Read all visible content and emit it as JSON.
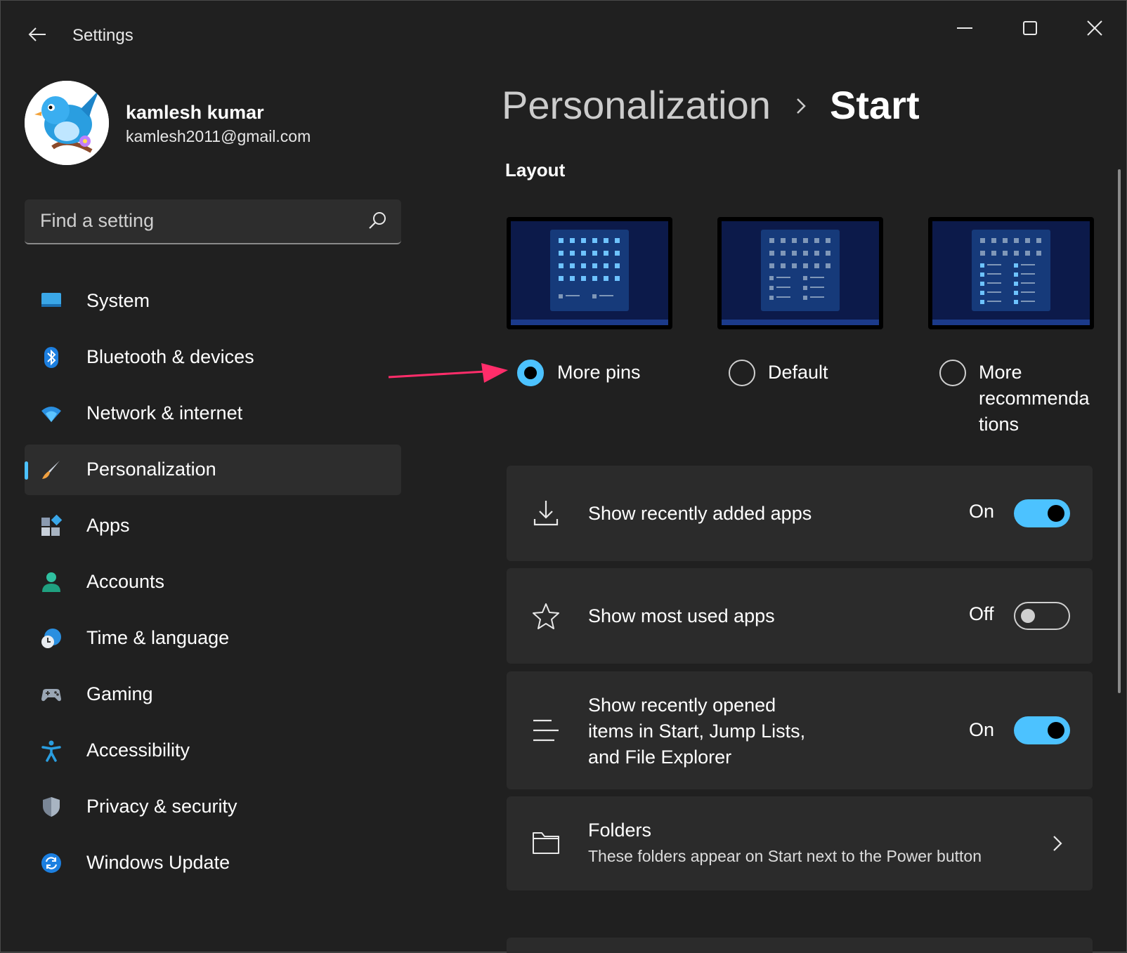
{
  "window": {
    "title": "Settings"
  },
  "profile": {
    "name": "kamlesh kumar",
    "email": "kamlesh2011@gmail.com"
  },
  "search": {
    "placeholder": "Find a setting"
  },
  "nav": {
    "items": [
      {
        "label": "System",
        "icon": "monitor-icon"
      },
      {
        "label": "Bluetooth & devices",
        "icon": "bluetooth-icon"
      },
      {
        "label": "Network & internet",
        "icon": "wifi-icon"
      },
      {
        "label": "Personalization",
        "icon": "brush-icon",
        "selected": true
      },
      {
        "label": "Apps",
        "icon": "apps-icon"
      },
      {
        "label": "Accounts",
        "icon": "person-icon"
      },
      {
        "label": "Time & language",
        "icon": "clock-globe-icon"
      },
      {
        "label": "Gaming",
        "icon": "gamepad-icon"
      },
      {
        "label": "Accessibility",
        "icon": "accessibility-icon"
      },
      {
        "label": "Privacy & security",
        "icon": "shield-icon"
      },
      {
        "label": "Windows Update",
        "icon": "update-icon"
      }
    ]
  },
  "header": {
    "breadcrumb_parent": "Personalization",
    "page_title": "Start"
  },
  "layout": {
    "section_title": "Layout",
    "options": [
      {
        "label": "More pins",
        "checked": true
      },
      {
        "label": "Default",
        "checked": false
      },
      {
        "label": "More\nrecommenda\ntions",
        "checked": false
      }
    ]
  },
  "settings": {
    "recent_apps": {
      "label": "Show recently added apps",
      "state": "On",
      "on": true
    },
    "most_used": {
      "label": "Show most used apps",
      "state": "Off",
      "on": false
    },
    "recent_items": {
      "label": "Show recently opened\nitems in Start, Jump Lists,\nand File Explorer",
      "state": "On",
      "on": true
    },
    "folders": {
      "label": "Folders",
      "description": "These folders appear on Start next to the Power button"
    }
  },
  "colors": {
    "accent": "#4cc2ff",
    "background": "#202020",
    "card": "#2b2b2b",
    "annotation_arrow": "#ff2d6a"
  }
}
